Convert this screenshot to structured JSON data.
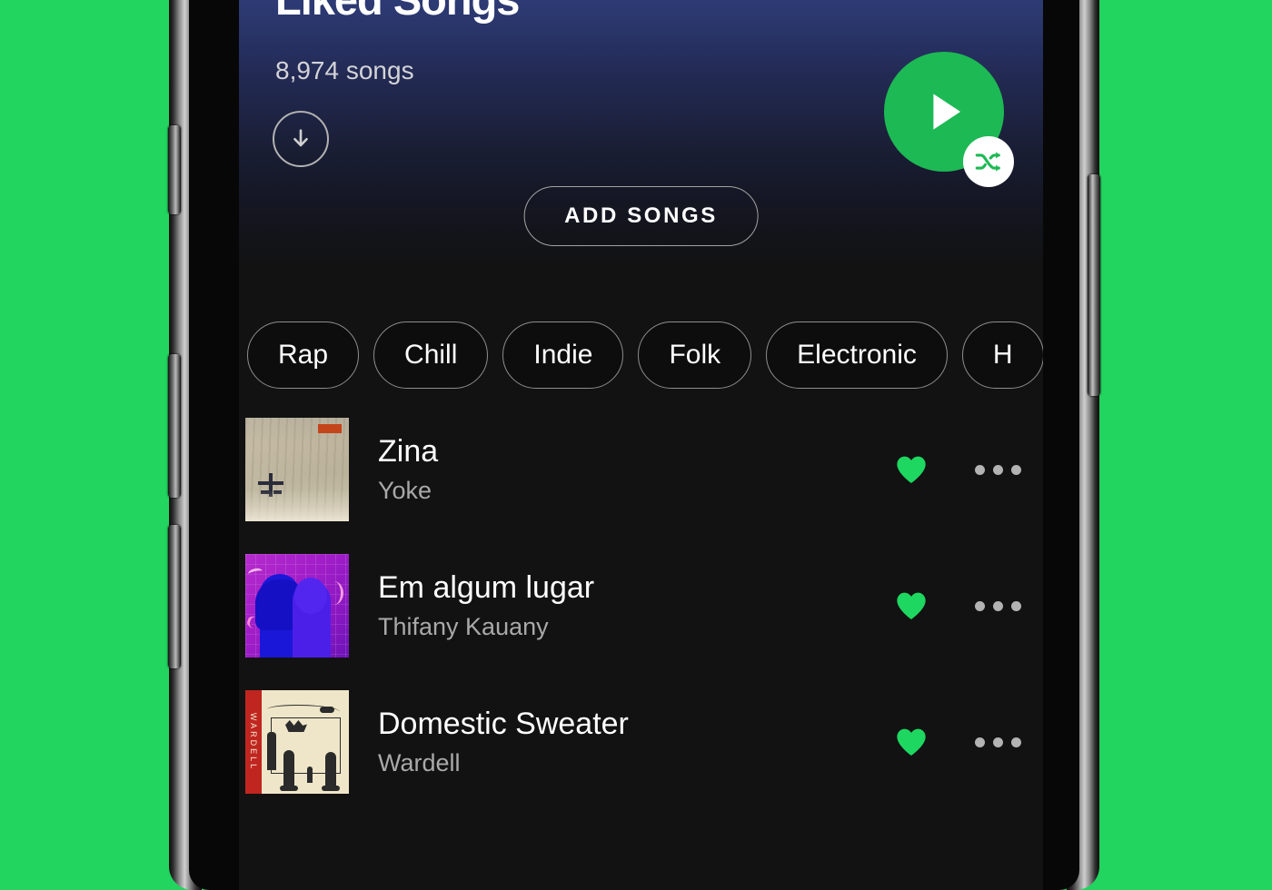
{
  "app": {
    "background_color": "#21d55f",
    "screen_background": "#121212",
    "accent_green": "#1db954",
    "heart_green": "#1ed760"
  },
  "header": {
    "title": "Liked Songs",
    "song_count": "8,974 songs",
    "download_icon": "download-arrow-icon",
    "play_icon": "play-icon",
    "shuffle_icon": "shuffle-icon",
    "add_songs_label": "ADD SONGS",
    "gradient_top_color": "#33407e",
    "gradient_bottom_color": "#121212"
  },
  "filters": {
    "chips": [
      {
        "label": "Rap"
      },
      {
        "label": "Chill"
      },
      {
        "label": "Indie"
      },
      {
        "label": "Folk"
      },
      {
        "label": "Electronic"
      },
      {
        "label": "H"
      }
    ]
  },
  "songs": [
    {
      "title": "Zina",
      "artist": "Yoke",
      "artwork": "beige-weathered-texture-album-art",
      "liked": true,
      "like_icon": "heart-filled-icon",
      "more_icon": "more-options-icon"
    },
    {
      "title": "Em algum lugar",
      "artist": "Thifany Kauany",
      "artwork": "purple-silhouettes-album-art",
      "liked": true,
      "like_icon": "heart-filled-icon",
      "more_icon": "more-options-icon"
    },
    {
      "title": "Domestic Sweater",
      "artist": "Wardell",
      "artwork": "cream-line-drawing-album-art",
      "artwork_stripe_text": "WARDELL",
      "liked": true,
      "like_icon": "heart-filled-icon",
      "more_icon": "more-options-icon"
    }
  ],
  "device": {
    "buttons": [
      {
        "name": "mute-switch"
      },
      {
        "name": "volume-up-button"
      },
      {
        "name": "volume-down-button"
      },
      {
        "name": "power-button"
      }
    ]
  }
}
